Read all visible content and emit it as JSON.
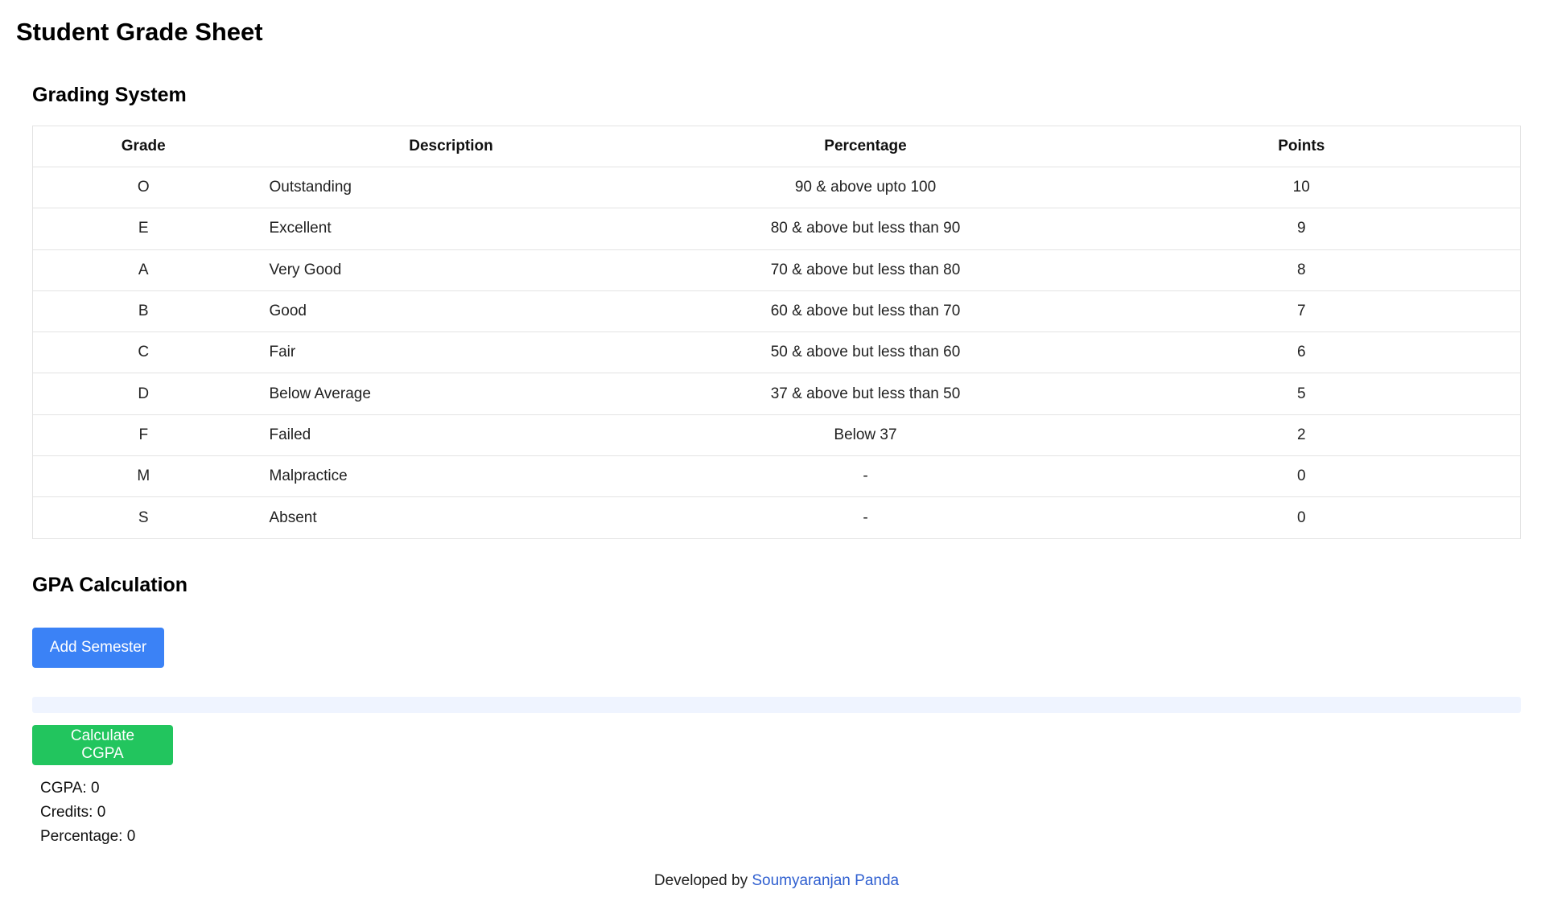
{
  "page": {
    "title": "Student Grade Sheet"
  },
  "grading": {
    "title": "Grading System",
    "headers": {
      "grade": "Grade",
      "description": "Description",
      "percentage": "Percentage",
      "points": "Points"
    },
    "rows": [
      {
        "grade": "O",
        "description": "Outstanding",
        "percentage": "90 & above upto 100",
        "points": "10"
      },
      {
        "grade": "E",
        "description": "Excellent",
        "percentage": "80 & above but less than 90",
        "points": "9"
      },
      {
        "grade": "A",
        "description": "Very Good",
        "percentage": "70 & above but less than 80",
        "points": "8"
      },
      {
        "grade": "B",
        "description": "Good",
        "percentage": "60 & above but less than 70",
        "points": "7"
      },
      {
        "grade": "C",
        "description": "Fair",
        "percentage": "50 & above but less than 60",
        "points": "6"
      },
      {
        "grade": "D",
        "description": "Below Average",
        "percentage": "37 & above but less than 50",
        "points": "5"
      },
      {
        "grade": "F",
        "description": "Failed",
        "percentage": "Below 37",
        "points": "2"
      },
      {
        "grade": "M",
        "description": "Malpractice",
        "percentage": "-",
        "points": "0"
      },
      {
        "grade": "S",
        "description": "Absent",
        "percentage": "-",
        "points": "0"
      }
    ]
  },
  "gpa": {
    "title": "GPA Calculation",
    "add_semester_label": "Add Semester",
    "calculate_label": "Calculate CGPA",
    "cgpa_text": "CGPA: 0",
    "credits_text": "Credits: 0",
    "percentage_text": "Percentage: 0"
  },
  "footer": {
    "prefix": "Developed by",
    "author": "Soumyaranjan Panda"
  },
  "colors": {
    "add_button": "#3b82f6",
    "calculate_button": "#22c55e",
    "link": "#2f5fd0"
  }
}
